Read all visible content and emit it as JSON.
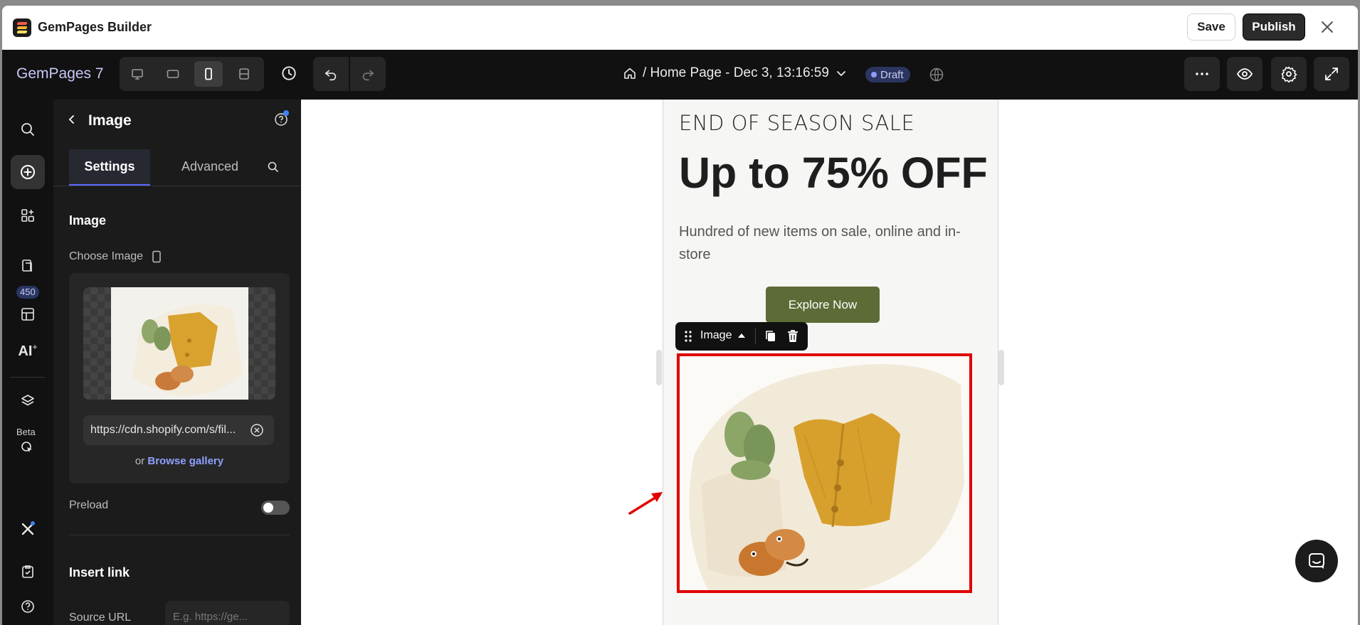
{
  "app": {
    "title": "GemPages Builder",
    "save_label": "Save",
    "publish_label": "Publish"
  },
  "topbar": {
    "brand": "GemPages 7",
    "page_label": "/ Home Page - Dec 3, 13:16:59",
    "status": "Draft",
    "active_device": "mobile"
  },
  "rail": {
    "badge_count": "450",
    "ai_label": "AI",
    "beta_label": "Beta"
  },
  "panel": {
    "title": "Image",
    "tabs": [
      "Settings",
      "Advanced"
    ],
    "active_tab": "Settings",
    "section_image": "Image",
    "choose_image_label": "Choose Image",
    "image_url": "https://cdn.shopify.com/s/fil...",
    "or_text": "or",
    "browse_label": "Browse gallery",
    "preload_label": "Preload",
    "preload_on": false,
    "insert_link_label": "Insert link",
    "source_url_label": "Source URL",
    "source_url_placeholder": "E.g. https://ge..."
  },
  "canvas": {
    "kicker": "END OF SEASON SALE",
    "headline": "Up to 75% OFF",
    "description": "Hundred of new items on sale, online and in-store",
    "cta_label": "Explore Now",
    "selected_element_label": "Image"
  },
  "colors": {
    "accent": "#5b6cff",
    "cta": "#5d6b36",
    "selection": "#e00000",
    "publish_bg": "#2b2b2b"
  }
}
